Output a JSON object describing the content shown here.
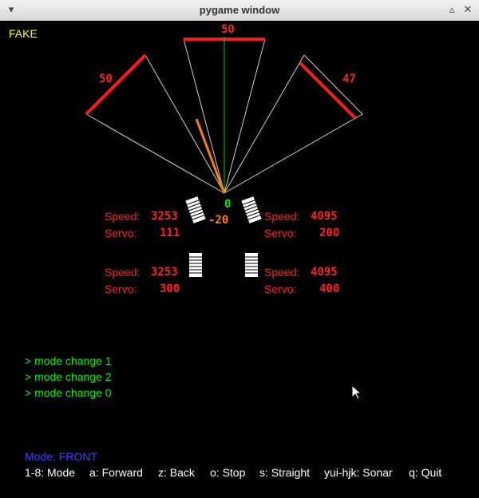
{
  "window": {
    "title": "pygame window"
  },
  "mode_flag": "FAKE",
  "sonar": {
    "left": "50",
    "center": "50",
    "right": "47"
  },
  "heading": {
    "value": "0",
    "offset": "-20"
  },
  "motors": {
    "front_left": {
      "speed_label": "Speed:",
      "speed": "3253",
      "servo_label": "Servo:",
      "servo": "111"
    },
    "front_right": {
      "speed_label": "Speed:",
      "speed": "4095",
      "servo_label": "Servo:",
      "servo": "200"
    },
    "rear_left": {
      "speed_label": "Speed:",
      "speed": "3253",
      "servo_label": "Servo:",
      "servo": "300"
    },
    "rear_right": {
      "speed_label": "Speed:",
      "speed": "4095",
      "servo_label": "Servo:",
      "servo": "400"
    }
  },
  "log": [
    "> mode change 1",
    "> mode change 2",
    "> mode change 0"
  ],
  "status": {
    "mode": "Mode: FRONT"
  },
  "help": {
    "modes": "1-8: Mode",
    "forward": "a: Forward",
    "back": "z: Back",
    "stop": "o: Stop",
    "straight": "s: Straight",
    "sonar": "yui-hjk: Sonar",
    "quit": "q: Quit"
  },
  "colors": {
    "sonar_bar": "#ff1a1a",
    "text_red": "#ff2020",
    "flag": "#ffff00",
    "log": "#00ee00",
    "mode": "#4040ff",
    "heading_line": "#00cc00",
    "steer_line": "#ff8000"
  }
}
